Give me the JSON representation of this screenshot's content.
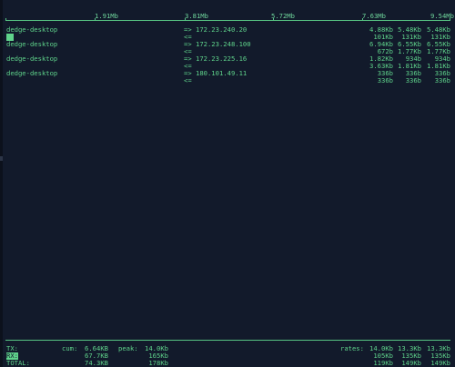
{
  "scale": {
    "ticks": [
      "1.91Mb",
      "3.81Mb",
      "5.72Mb",
      "7.63Mb",
      "9.54Mb"
    ]
  },
  "rows": [
    {
      "host": "dedge-desktop",
      "dir1": "=>",
      "peer": "172.23.240.20",
      "tx": [
        "4.88Kb",
        "5.48Kb",
        "5.48Kb"
      ],
      "dir2": "<=",
      "rx": [
        "101Kb",
        "131Kb",
        "131Kb"
      ]
    },
    {
      "host": "dedge-desktop",
      "dir1": "=>",
      "peer": "172.23.248.100",
      "tx": [
        "6.94Kb",
        "6.55Kb",
        "6.55Kb"
      ],
      "dir2": "<=",
      "rx": [
        "672b",
        "1.77Kb",
        "1.77Kb"
      ]
    },
    {
      "host": "dedge-desktop",
      "dir1": "=>",
      "peer": "172.23.225.16",
      "tx": [
        "1.82Kb",
        "934b",
        "934b"
      ],
      "dir2": "<=",
      "rx": [
        "3.63Kb",
        "1.81Kb",
        "1.81Kb"
      ]
    },
    {
      "host": "dedge-desktop",
      "dir1": "=>",
      "peer": "180.101.49.11",
      "tx": [
        "336b",
        "336b",
        "336b"
      ],
      "dir2": "<=",
      "rx": [
        "336b",
        "336b",
        "336b"
      ]
    }
  ],
  "footer": {
    "tx_label": "TX:",
    "rx_label": "RX:",
    "total_label": "TOTAL:",
    "cum_label": "cum:",
    "peak_label": "peak:",
    "rates_label": "rates:",
    "tx_cum": "6.64KB",
    "rx_cum": "67.7KB",
    "total_cum": "74.3KB",
    "tx_peak": "14.0Kb",
    "rx_peak": "165Kb",
    "total_peak": "178Kb",
    "tx_rates": [
      "14.0Kb",
      "13.3Kb",
      "13.3Kb"
    ],
    "rx_rates": [
      "105Kb",
      "135Kb",
      "135Kb"
    ],
    "total_rates": [
      "119Kb",
      "149Kb",
      "149Kb"
    ]
  }
}
